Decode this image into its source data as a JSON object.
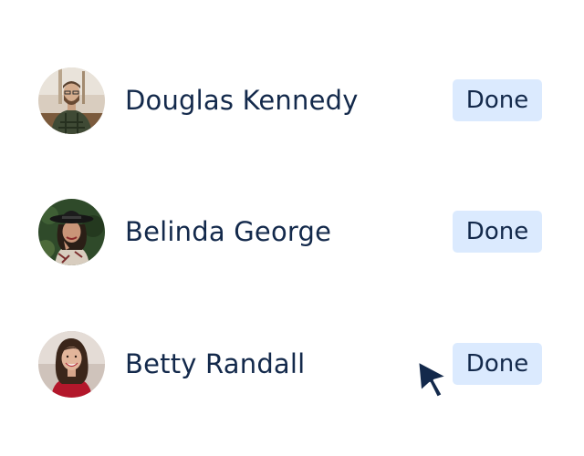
{
  "people": [
    {
      "name": "Douglas Kennedy",
      "action": "Done",
      "avatar": "avatar-douglas-kennedy"
    },
    {
      "name": "Belinda George",
      "action": "Done",
      "avatar": "avatar-belinda-george"
    },
    {
      "name": "Betty Randall",
      "action": "Done",
      "avatar": "avatar-betty-randall"
    }
  ],
  "colors": {
    "text": "#13294b",
    "button_bg": "#dbeafe",
    "cursor": "#13294b"
  },
  "icons": {
    "pointer": "mouse-pointer-icon"
  }
}
